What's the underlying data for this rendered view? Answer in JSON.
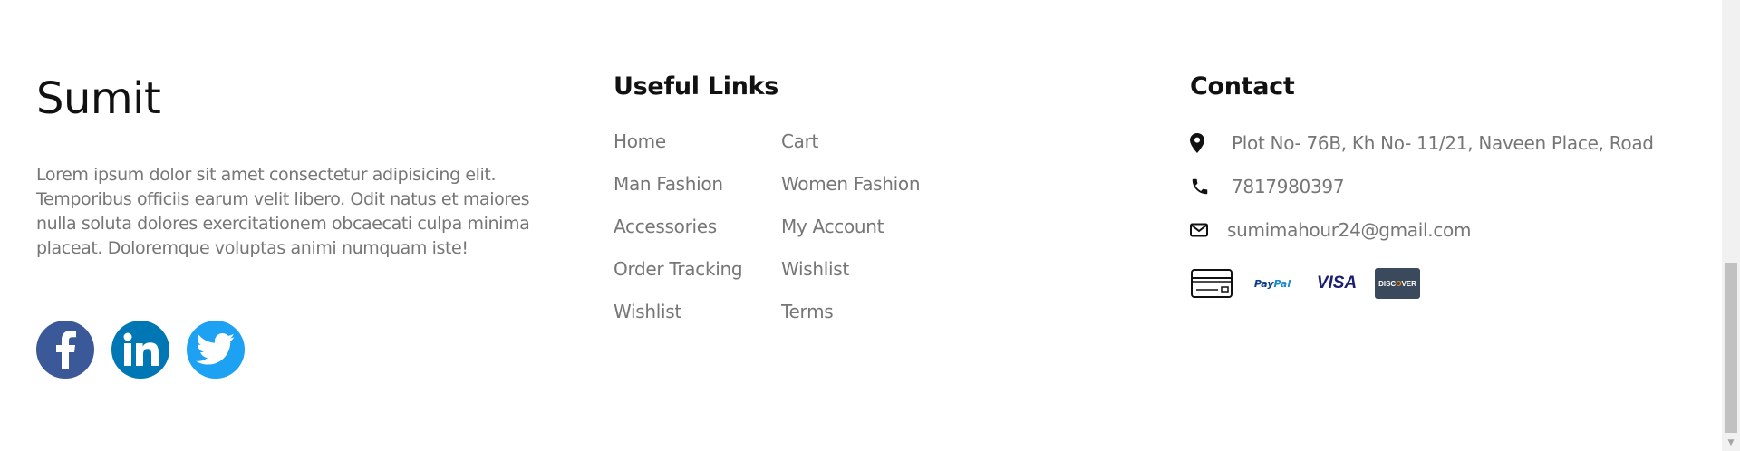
{
  "brand": {
    "title": "Sumit",
    "description": "Lorem ipsum dolor sit amet consectetur adipisicing elit. Temporibus officiis earum velit libero. Odit natus et maiores nulla soluta dolores exercitationem obcaecati culpa minima placeat. Doloremque voluptas animi numquam iste!",
    "social": [
      {
        "icon": "facebook-icon",
        "color": "#3b5998"
      },
      {
        "icon": "linkedin-icon",
        "color": "#0077b5"
      },
      {
        "icon": "twitter-icon",
        "color": "#1da1f2"
      }
    ]
  },
  "useful_links": {
    "heading": "Useful Links",
    "items": [
      "Home",
      "Cart",
      "Man Fashion",
      "Women Fashion",
      "Accessories",
      "My Account",
      "Order Tracking",
      "Wishlist",
      "Wishlist",
      "Terms"
    ]
  },
  "contact": {
    "heading": "Contact",
    "address": "Plot No- 76B, Kh No- 11/21, Naveen Place, Road",
    "phone": "7817980397",
    "email": "sumimahour24@gmail.com",
    "payments": {
      "card_icon": "credit-card-icon",
      "paypal_pay": "Pay",
      "paypal_pal": "Pal",
      "visa": "VISA",
      "discover_pre": "DISC",
      "discover_o": "O",
      "discover_post": "VER"
    }
  },
  "colors": {
    "text_dark": "#111111",
    "text_muted": "#767676"
  }
}
